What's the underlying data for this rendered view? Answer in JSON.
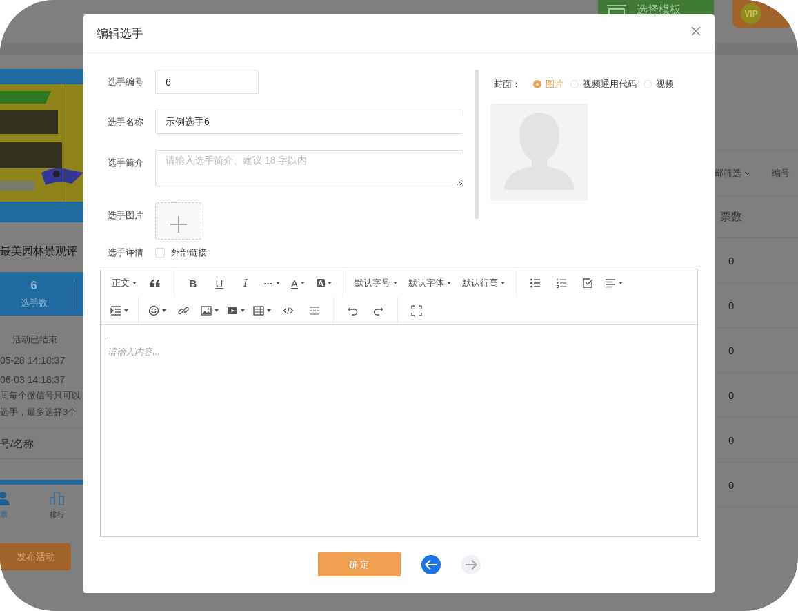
{
  "background": {
    "template_button": "选择模板",
    "vip_badge": "VIP",
    "banner": {
      "kind": "picture"
    },
    "activity_title": "最美园林景观评",
    "stats": [
      {
        "value": "6",
        "label": "选手数"
      }
    ],
    "status": "活动已结束",
    "times": [
      "05-28 14:18:37",
      "06-03 14:18:37"
    ],
    "rules": [
      "间每个微信号只可以",
      "选手，最多选择3个"
    ],
    "search_hint": "号/名称",
    "nav": [
      {
        "label": "票",
        "selected": true
      },
      {
        "label": "排行",
        "selected": false
      }
    ],
    "publish_button": "发布活动",
    "filters": [
      {
        "label": "部筛选",
        "dropdown": true
      },
      {
        "label": "编号",
        "dropdown": false
      }
    ],
    "table": {
      "columns": [
        "票数"
      ],
      "rows": [
        [
          "0"
        ],
        [
          "0"
        ],
        [
          "0"
        ],
        [
          "0"
        ],
        [
          "0"
        ],
        [
          "0"
        ]
      ]
    }
  },
  "dialog": {
    "title": "编辑选手",
    "fields": [
      {
        "kind": "short_input",
        "label": "选手编号",
        "value": "6"
      },
      {
        "kind": "input",
        "label": "选手名称",
        "value": "示例选手6"
      },
      {
        "kind": "textarea",
        "label": "选手简介",
        "placeholder": "请输入选手简介、建议 18 字以内"
      },
      {
        "kind": "upload",
        "label": "选手图片"
      },
      {
        "kind": "checkbox",
        "label": "选手详情",
        "option": "外部链接",
        "checked": false
      }
    ],
    "cover": {
      "label": "封面：",
      "options": [
        {
          "label": "图片",
          "selected": true
        },
        {
          "label": "视频通用代码",
          "selected": false
        },
        {
          "label": "视频",
          "selected": false
        }
      ]
    },
    "editor": {
      "toolbar": [
        [
          [
            {
              "kind": "dropdown",
              "label": "正文"
            },
            {
              "kind": "icon"
            }
          ],
          [
            {
              "kind": "glyph",
              "text": "B"
            },
            {
              "kind": "glyph",
              "text": "U"
            },
            {
              "kind": "glyph",
              "text": "I"
            },
            {
              "kind": "glyph",
              "text": "···"
            },
            {
              "kind": "glyph",
              "text": "A"
            },
            {
              "kind": "glyph",
              "text": "A"
            }
          ],
          [
            {
              "kind": "dropdown",
              "label": "默认字号"
            },
            {
              "kind": "dropdown",
              "label": "默认字体"
            },
            {
              "kind": "dropdown",
              "label": "默认行高"
            }
          ],
          [
            {
              "kind": "icon"
            },
            {
              "kind": "icon"
            },
            {
              "kind": "icon"
            },
            {
              "kind": "icon"
            }
          ]
        ],
        [
          [
            {
              "kind": "icon"
            }
          ],
          [
            {
              "kind": "icon"
            },
            {
              "kind": "icon"
            },
            {
              "kind": "icon"
            },
            {
              "kind": "icon"
            },
            {
              "kind": "icon"
            },
            {
              "kind": "icon"
            },
            {
              "kind": "icon"
            }
          ],
          [
            {
              "kind": "icon"
            },
            {
              "kind": "icon"
            }
          ],
          [
            {
              "kind": "icon"
            }
          ]
        ]
      ],
      "placeholder": "请输入内容..."
    },
    "confirm_button": "确 定",
    "nav_buttons": [
      {
        "kind": "back",
        "disabled": false
      },
      {
        "kind": "forward",
        "disabled": true
      }
    ]
  }
}
